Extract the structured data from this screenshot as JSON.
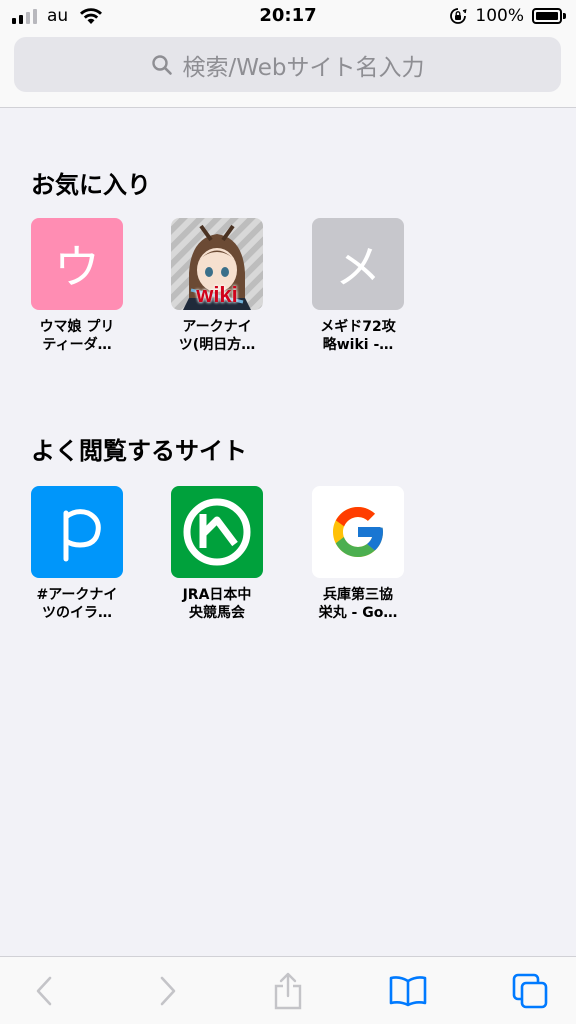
{
  "status_bar": {
    "carrier": "au",
    "time": "20:17",
    "battery": "100%",
    "icons": [
      "signal-icon",
      "wifi-icon",
      "orientation-lock-icon",
      "battery-icon"
    ]
  },
  "search": {
    "placeholder": "検索/Webサイト名入力"
  },
  "favorites": {
    "title": "お気に入り",
    "items": [
      {
        "label": "ウマ娘 プリ\nティーダ…",
        "icon_text": "ウ",
        "color": "#ff8db3"
      },
      {
        "label": "アークナイ\nツ(明日方…",
        "icon_text": "wiki",
        "color": "#ffffff"
      },
      {
        "label": "メギド72攻\n略wiki -…",
        "icon_text": "メ",
        "color": "#c7c7cc"
      }
    ]
  },
  "frequent": {
    "title": "よく閲覧するサイト",
    "items": [
      {
        "label": "#アークナイ\nツのイラ…",
        "icon": "pixiv-icon",
        "color": "#0096fa"
      },
      {
        "label": "JRA日本中\n央競馬会",
        "icon": "jra-icon",
        "color": "#00a13c"
      },
      {
        "label": "兵庫第三協\n栄丸 - Go…",
        "icon": "google-icon",
        "color": "#ffffff"
      }
    ]
  },
  "toolbar": {
    "buttons": [
      "back-icon",
      "forward-icon",
      "share-icon",
      "bookmarks-icon",
      "tabs-icon"
    ],
    "accent": "#007aff"
  }
}
